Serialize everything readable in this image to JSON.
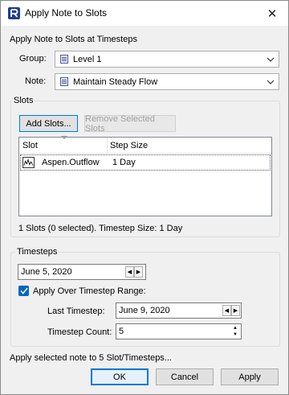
{
  "window": {
    "title": "Apply Note to Slots",
    "close_glyph": "✕"
  },
  "timesteps_section_label": "Apply Note to Slots at Timesteps",
  "group": {
    "label": "Group:",
    "value": "Level 1",
    "icon": "sheet-icon"
  },
  "note": {
    "label": "Note:",
    "value": "Maintain Steady Flow",
    "icon": "sheet-icon"
  },
  "slots": {
    "group_title": "Slots",
    "add_button": "Add Slots...",
    "remove_button": "Remove Selected Slots",
    "columns": [
      "Slot",
      "Step Size"
    ],
    "rows": [
      {
        "slot": "Aspen.Outflow",
        "step_size": "1 Day",
        "icon": "series-slot-icon"
      }
    ],
    "status": "1 Slots (0 selected).  Timestep Size:  1 Day"
  },
  "timesteps": {
    "group_title": "Timesteps",
    "start_date": "June 5, 2020",
    "range_checkbox_label": "Apply Over Timestep Range:",
    "range_checked": true,
    "last_timestep_label": "Last Timestep:",
    "last_timestep_value": "June 9, 2020",
    "count_label": "Timestep Count:",
    "count_value": "5"
  },
  "summary": "Apply selected note to 5 Slot/Timesteps...",
  "buttons": {
    "ok": "OK",
    "cancel": "Cancel",
    "apply": "Apply"
  }
}
